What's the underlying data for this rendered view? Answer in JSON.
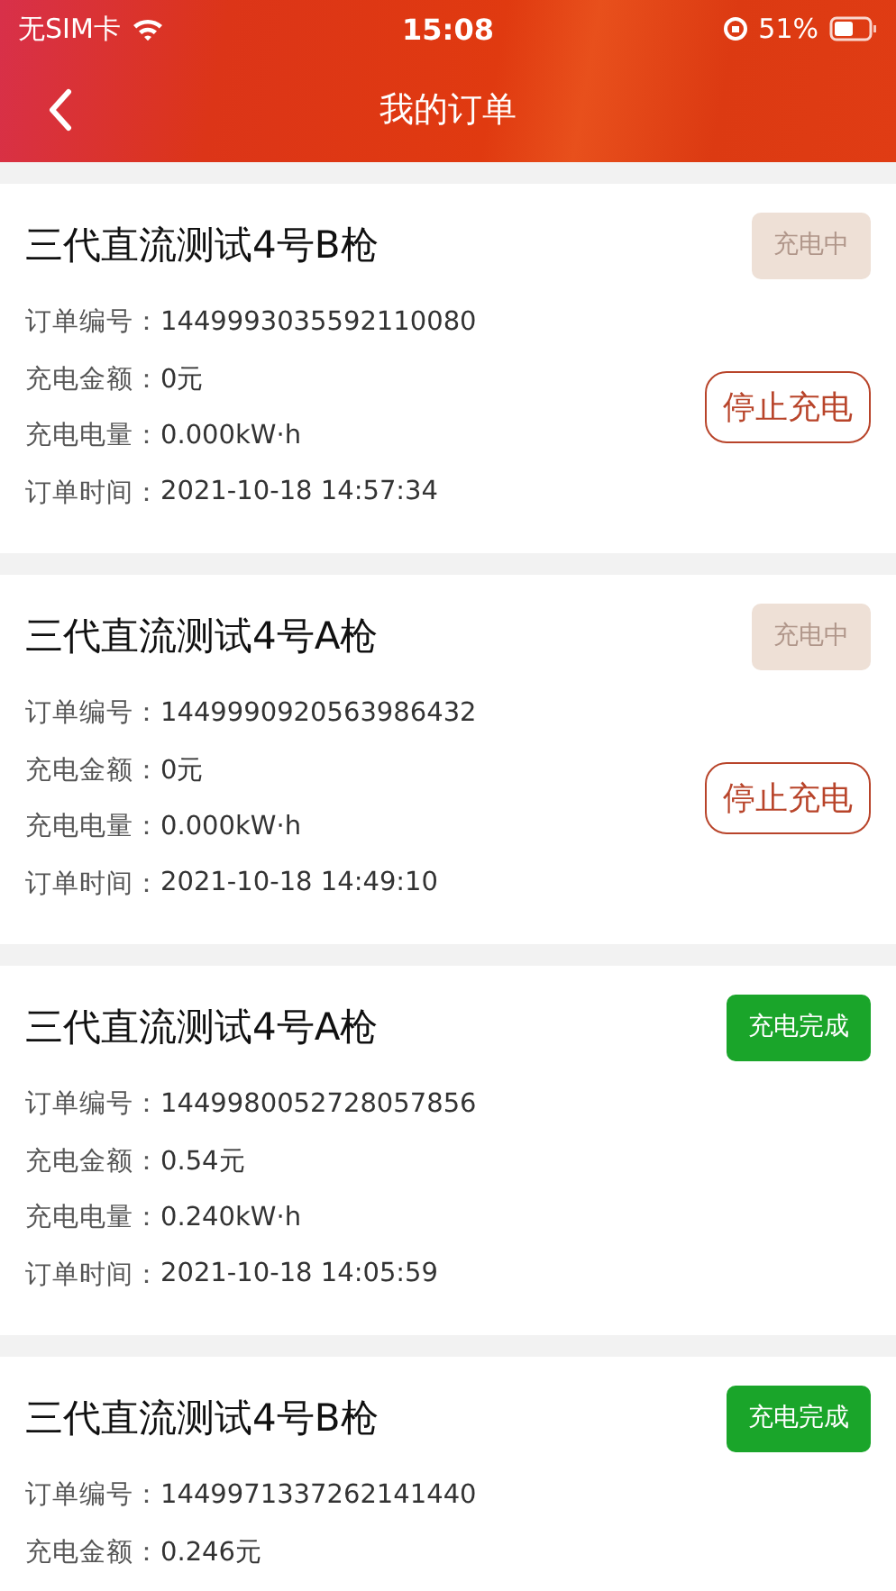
{
  "status_bar": {
    "carrier": "无SIM卡",
    "time": "15:08",
    "battery": "51%"
  },
  "nav": {
    "title": "我的订单"
  },
  "orders": [
    {
      "title": "三代直流测试4号B枪",
      "status": {
        "kind": "charging",
        "label": "充电中"
      },
      "stop_button": "停止充电",
      "fields": [
        {
          "label": "订单编号：",
          "value": "1449993035592110080"
        },
        {
          "label": "充电金额：",
          "value": "0元"
        },
        {
          "label": "充电电量：",
          "value": "0.000kW·h"
        },
        {
          "label": "订单时间：",
          "value": "2021-10-18 14:57:34"
        }
      ]
    },
    {
      "title": "三代直流测试4号A枪",
      "status": {
        "kind": "charging",
        "label": "充电中"
      },
      "stop_button": "停止充电",
      "fields": [
        {
          "label": "订单编号：",
          "value": "1449990920563986432"
        },
        {
          "label": "充电金额：",
          "value": "0元"
        },
        {
          "label": "充电电量：",
          "value": "0.000kW·h"
        },
        {
          "label": "订单时间：",
          "value": "2021-10-18 14:49:10"
        }
      ]
    },
    {
      "title": "三代直流测试4号A枪",
      "status": {
        "kind": "done",
        "label": "充电完成"
      },
      "fields": [
        {
          "label": "订单编号：",
          "value": "1449980052728057856"
        },
        {
          "label": "充电金额：",
          "value": "0.54元"
        },
        {
          "label": "充电电量：",
          "value": "0.240kW·h"
        },
        {
          "label": "订单时间：",
          "value": "2021-10-18 14:05:59"
        }
      ]
    },
    {
      "title": "三代直流测试4号B枪",
      "status": {
        "kind": "done",
        "label": "充电完成"
      },
      "fields": [
        {
          "label": "订单编号：",
          "value": "1449971337262141440"
        },
        {
          "label": "充电金额：",
          "value": "0.246元"
        }
      ]
    }
  ]
}
